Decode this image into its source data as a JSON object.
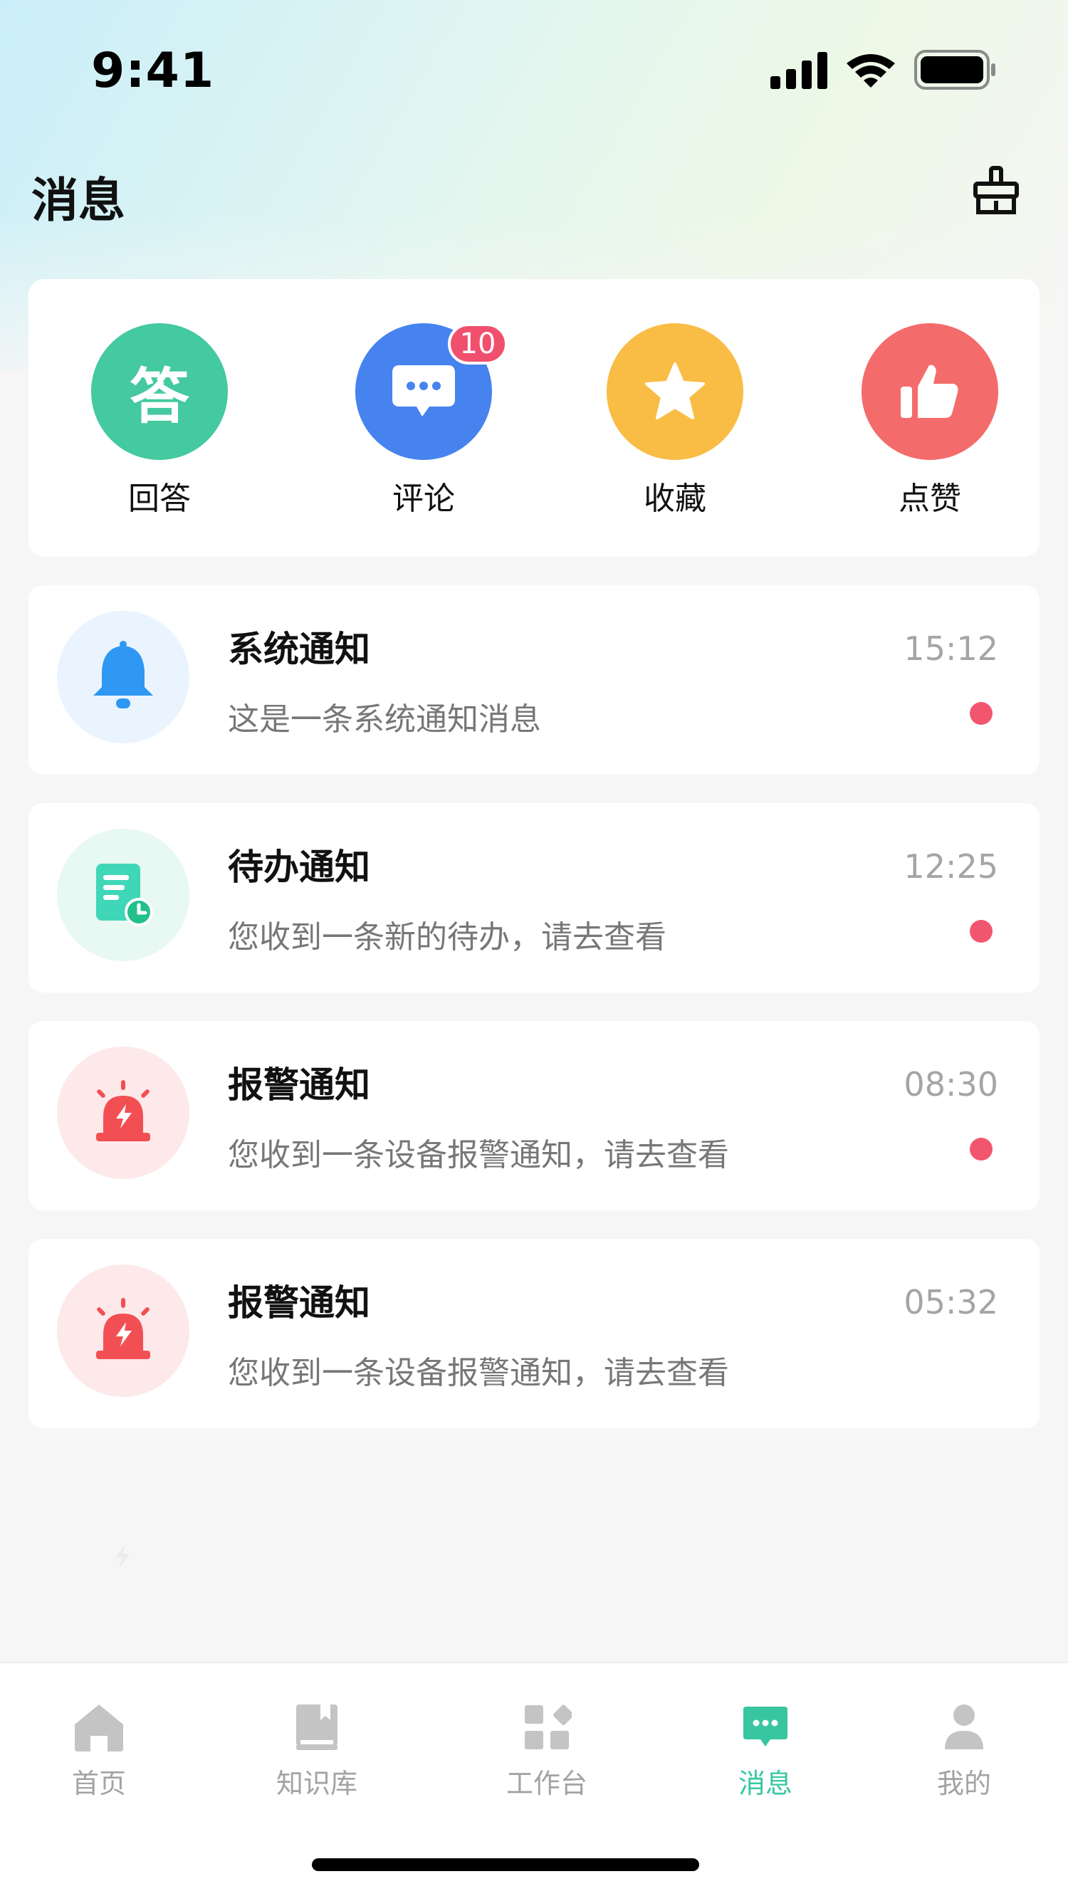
{
  "status_bar": {
    "time": "9:41"
  },
  "header": {
    "title": "消息",
    "action_icon": "broom-clean-icon"
  },
  "quick_actions": [
    {
      "label": "回答",
      "icon_text": "答",
      "icon": "answer-icon",
      "color": "#44c9a0"
    },
    {
      "label": "评论",
      "icon": "comment-bubble-icon",
      "color": "#4683ee",
      "badge": "10"
    },
    {
      "label": "收藏",
      "icon": "star-icon",
      "color": "#f9bd45"
    },
    {
      "label": "点赞",
      "icon": "thumbs-up-icon",
      "color": "#f46b6b"
    }
  ],
  "messages": [
    {
      "title": "系统通知",
      "preview": "这是一条系统通知消息",
      "time": "15:12",
      "unread": true,
      "icon": "bell-icon"
    },
    {
      "title": "待办通知",
      "preview": "您收到一条新的待办，请去查看",
      "time": "12:25",
      "unread": true,
      "icon": "todo-document-icon"
    },
    {
      "title": "报警通知",
      "preview": "您收到一条设备报警通知，请去查看",
      "time": "08:30",
      "unread": true,
      "icon": "alarm-siren-icon"
    },
    {
      "title": "报警通知",
      "preview": "您收到一条设备报警通知，请去查看",
      "time": "05:32",
      "unread": false,
      "icon": "alarm-siren-icon"
    }
  ],
  "tabs": [
    {
      "label": "首页",
      "icon": "home-icon",
      "active": false
    },
    {
      "label": "知识库",
      "icon": "book-icon",
      "active": false
    },
    {
      "label": "工作台",
      "icon": "workbench-grid-icon",
      "active": false
    },
    {
      "label": "消息",
      "icon": "message-bubble-icon",
      "active": true
    },
    {
      "label": "我的",
      "icon": "user-icon",
      "active": false
    }
  ],
  "colors": {
    "accent": "#37c6a0",
    "unread": "#f2566f",
    "inactive_tab": "#a3a3a3"
  }
}
